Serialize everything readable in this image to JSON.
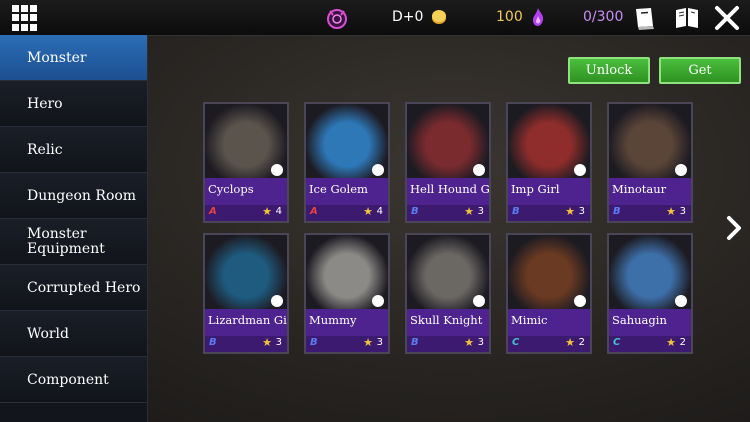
{
  "topbar": {
    "day": "D+0",
    "mana": "100",
    "capacity": "0/300",
    "menu_icon": "grid-menu-icon",
    "clock_icon": "demon-clock-icon",
    "coin_icon": "coin-icon",
    "mana_icon": "purple-flame-icon",
    "book_icon": "book-icon",
    "pages_icon": "open-book-icon",
    "close_icon": "close-icon",
    "colors": {
      "mana": "#f3c85a",
      "capacity": "#c98ef5"
    }
  },
  "sidebar": {
    "items": [
      {
        "label": "Monster",
        "active": true
      },
      {
        "label": "Hero"
      },
      {
        "label": "Relic"
      },
      {
        "label": "Dungeon Room"
      },
      {
        "label": "Monster\nEquipment"
      },
      {
        "label": "Corrupted Hero"
      },
      {
        "label": "World"
      },
      {
        "label": "Component"
      }
    ],
    "accent": "#2c6eb5"
  },
  "actions": {
    "unlock": "Unlock",
    "get": "Get",
    "color": "#3da82f"
  },
  "cards": [
    {
      "name": "Cyclops",
      "rank": "A",
      "level": "4",
      "art_color": "#5a544c"
    },
    {
      "name": "Ice Golem",
      "rank": "A",
      "level": "4",
      "art_color": "#2e78b8"
    },
    {
      "name": "Hell Hound Girl",
      "rank": "B",
      "level": "3",
      "art_color": "#7a2b2e"
    },
    {
      "name": "Imp Girl",
      "rank": "B",
      "level": "3",
      "art_color": "#8e2d2b"
    },
    {
      "name": "Minotaur",
      "rank": "B",
      "level": "3",
      "art_color": "#5b4539"
    },
    {
      "name": "Lizardman Girl",
      "rank": "B",
      "level": "3",
      "art_color": "#1e5b7e"
    },
    {
      "name": "Mummy",
      "rank": "B",
      "level": "3",
      "art_color": "#8c8a86"
    },
    {
      "name": "Skull Knight",
      "rank": "B",
      "level": "3",
      "art_color": "#6b6763"
    },
    {
      "name": "Mimic",
      "rank": "C",
      "level": "2",
      "art_color": "#6a3a22"
    },
    {
      "name": "Sahuagin",
      "rank": "C",
      "level": "2",
      "art_color": "#3d6fa8"
    }
  ],
  "rank_colors": {
    "A": "#e84242",
    "B": "#5a7cf2",
    "C": "#3fc2c9"
  },
  "next_icon": "chevron-right-icon"
}
